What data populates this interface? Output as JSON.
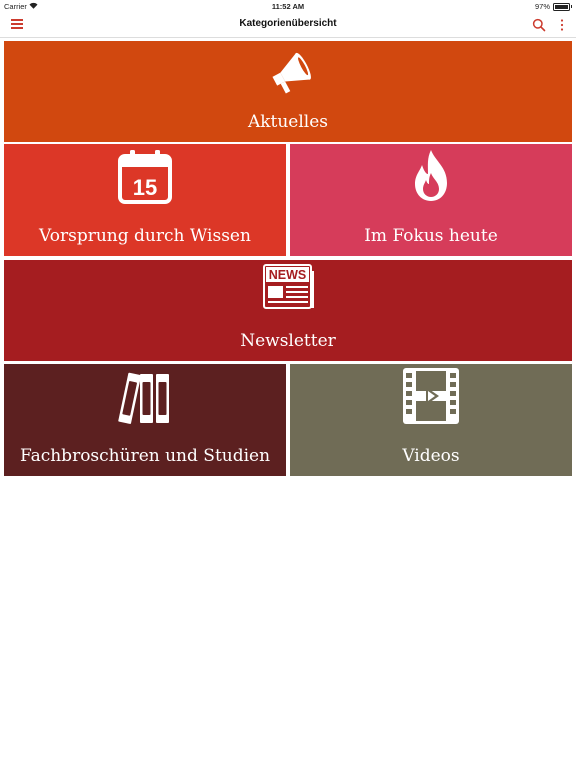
{
  "status_bar": {
    "carrier": "Carrier",
    "time": "11:52 AM",
    "battery": "97%",
    "battery_level": 0.97
  },
  "navbar": {
    "title": "Kategorienübersicht",
    "left_icon": "hamburger-menu-icon",
    "right_icons": [
      "search-icon",
      "more-vert-icon"
    ],
    "accent": "#cc3b2e"
  },
  "tiles": [
    {
      "label": "Aktuelles",
      "icon": "megaphone-icon",
      "color": "#d1480f"
    },
    {
      "label": "Vorsprung durch Wissen",
      "icon": "calendar-icon",
      "icon_text": "15",
      "color": "#dc3727"
    },
    {
      "label": "Im Fokus heute",
      "icon": "flame-icon",
      "color": "#d63c5a"
    },
    {
      "label": "Newsletter",
      "icon": "newspaper-icon",
      "icon_text": "NEWS",
      "color": "#a51d20"
    },
    {
      "label": "Fachbroschüren und Studien",
      "icon": "books-icon",
      "color": "#5c2020"
    },
    {
      "label": "Videos",
      "icon": "film-icon",
      "color": "#706c56"
    }
  ]
}
